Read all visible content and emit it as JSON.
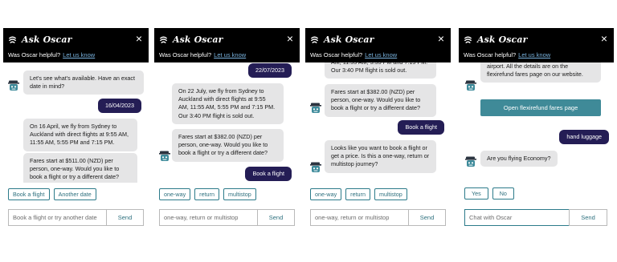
{
  "panels": [
    {
      "header": {
        "title": "Ask Oscar",
        "close": "×",
        "helpful_text": "Was Oscar helpful?",
        "helpful_link": "Let us know"
      },
      "messages": [
        {
          "from": "bot",
          "text": "Let's see what's available. Have an exact date in mind?"
        },
        {
          "from": "user",
          "text": "16/04/2023"
        },
        {
          "from": "bot",
          "text": "On 16 April, we fly from Sydney to Auckland with direct flights at 9:55 AM, 11:55 AM, 5:55 PM and 7:15 PM."
        },
        {
          "from": "bot",
          "text": "Fares start at $511.00 (NZD) per person, one-way. Would you like to book a flight or try a different date?"
        }
      ],
      "quick_replies": [
        "Book a flight",
        "Another date"
      ],
      "input": {
        "placeholder": "Book a flight or try another date",
        "value": ""
      },
      "send_label": "Send"
    },
    {
      "header": {
        "title": "Ask Oscar",
        "close": "×",
        "helpful_text": "Was Oscar helpful?",
        "helpful_link": "Let us know"
      },
      "messages": [
        {
          "from": "user",
          "text": "22/07/2023"
        },
        {
          "from": "bot",
          "text": "On 22 July, we fly from Sydney to Auckland with direct flights at 9:55 AM, 11:55 AM, 5:55 PM and 7:15 PM. Our 3:40 PM flight is sold out."
        },
        {
          "from": "bot",
          "text": "Fares start at $382.00 (NZD) per person, one-way. Would you like to book a flight or try a different date?"
        },
        {
          "from": "user",
          "text": "Book a flight"
        }
      ],
      "quick_replies": [
        "one-way",
        "return",
        "multistop"
      ],
      "input": {
        "placeholder": "one-way, return or multistop",
        "value": ""
      },
      "send_label": "Send"
    },
    {
      "header": {
        "title": "Ask Oscar",
        "close": "×",
        "helpful_text": "Was Oscar helpful?",
        "helpful_link": "Let us know"
      },
      "messages": [
        {
          "from": "bot",
          "text": "AM, 11:55 AM, 5:55 PM and 7:15 PM. Our 3:40 PM flight is sold out."
        },
        {
          "from": "bot",
          "text": "Fares start at $382.00 (NZD) per person, one-way. Would you like to book a flight or try a different date?"
        },
        {
          "from": "user",
          "text": "Book a flight"
        },
        {
          "from": "bot",
          "text": "Looks like you want to book a flight or get a price. Is this a one-way, return or multistop journey?"
        }
      ],
      "quick_replies": [
        "one-way",
        "return",
        "multistop"
      ],
      "input": {
        "placeholder": "one-way, return or multistop",
        "value": ""
      },
      "send_label": "Send"
    },
    {
      "header": {
        "title": "Ask Oscar",
        "close": "×",
        "helpful_text": "Was Oscar helpful?",
        "helpful_link": "Let us know"
      },
      "messages": [
        {
          "from": "bot",
          "text": "airport. All the details are on the flexirefund fares page on our website."
        },
        {
          "from": "user",
          "text": "hand luggage"
        },
        {
          "from": "bot",
          "text": "Are you flying Economy?"
        }
      ],
      "cta_label": "Open flexirefund fares page",
      "quick_replies": [
        "Yes",
        "No"
      ],
      "input": {
        "placeholder": "Chat with Oscar",
        "value": ""
      },
      "send_label": "Send"
    }
  ],
  "colors": {
    "header_bg": "#000000",
    "user_bubble": "#241d55",
    "bot_bubble": "#e5e5e6",
    "accent": "#2c7b8a",
    "cta": "#3f8a98",
    "link": "#7ab4e0"
  },
  "icons": {
    "brand": "oscar-logo-icon",
    "close": "close-icon",
    "avatar": "oscar-avatar-icon"
  }
}
